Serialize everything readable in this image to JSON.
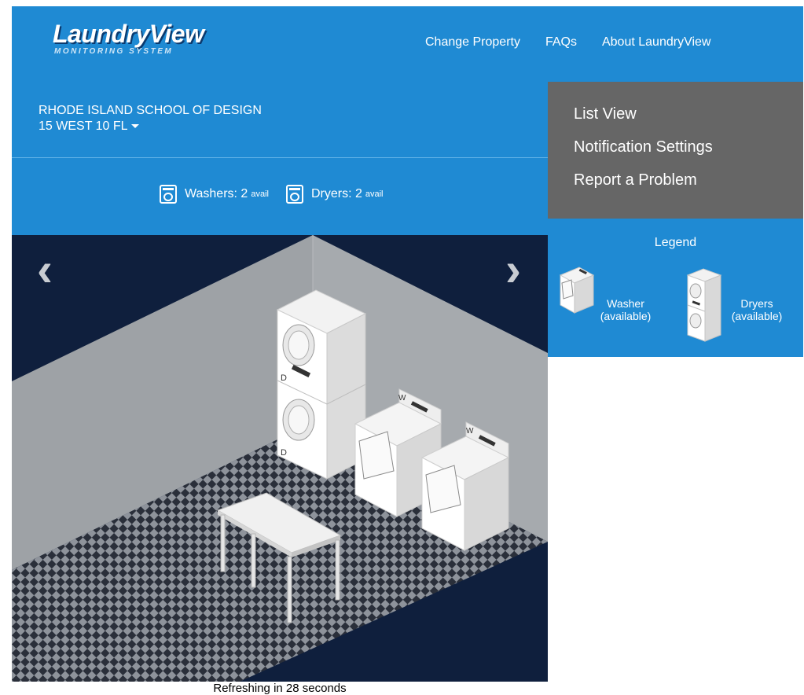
{
  "header": {
    "logo_title": "LaundryView",
    "logo_subtitle": "MONITORING SYSTEM",
    "nav": [
      "Change Property",
      "FAQs",
      "About LaundryView"
    ]
  },
  "location": {
    "school": "RHODE ISLAND SCHOOL OF DESIGN",
    "room": "15 WEST 10 FL"
  },
  "availability": {
    "washers_label": "Washers: 2",
    "washers_suffix": "avail",
    "dryers_label": "Dryers: 2",
    "dryers_suffix": "avail"
  },
  "menu": {
    "items": [
      "List View",
      "Notification Settings",
      "Report a Problem"
    ]
  },
  "legend": {
    "title": "Legend",
    "washer_label": "Washer",
    "washer_status": "(available)",
    "dryer_label": "Dryers",
    "dryer_status": "(available)"
  },
  "room_view": {
    "washer_tag": "W",
    "dryer_tag": "D"
  },
  "status": {
    "refresh": "Refreshing in 28 seconds"
  },
  "colors": {
    "header_blue": "#1f8ad3",
    "menu_gray": "#666666",
    "floor_navy": "#0f1f3d",
    "wall_gray": "#9ea2a6"
  }
}
